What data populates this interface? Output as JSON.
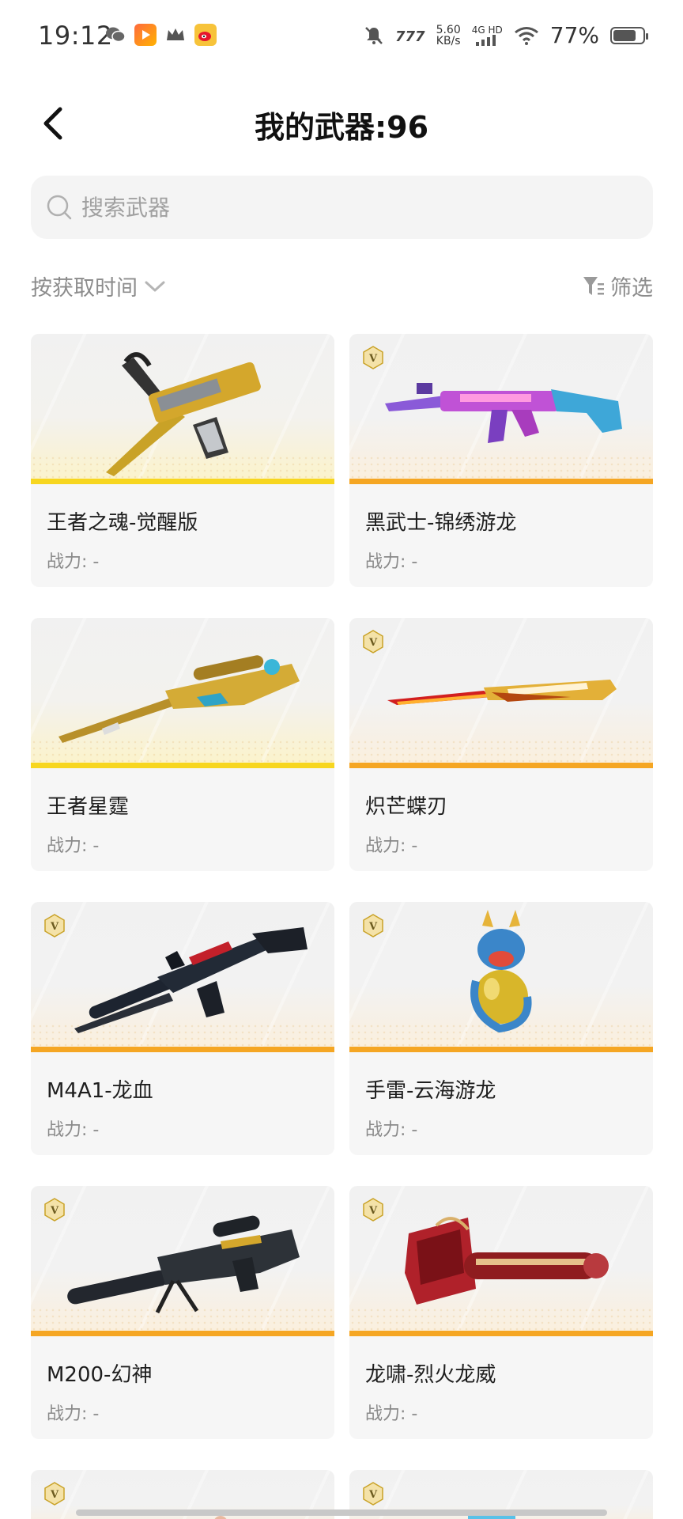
{
  "status_bar": {
    "time": "19:12",
    "speed_value": "5.60",
    "speed_unit": "KB/s",
    "network": "4G HD",
    "battery_percent": "77%",
    "battery_level": 0.77
  },
  "header": {
    "title": "我的武器:96"
  },
  "search": {
    "placeholder": "搜索武器"
  },
  "toolbar": {
    "sort_label": "按获取时间",
    "filter_label": "筛选"
  },
  "weapons": [
    {
      "name": "王者之魂-觉醒版",
      "power": "战力: -",
      "badge": false,
      "tier": "gold",
      "icon": "pistol-dagger-icon"
    },
    {
      "name": "黑武士-锦绣游龙",
      "power": "战力: -",
      "badge": true,
      "tier": "orange",
      "icon": "rifle-icon"
    },
    {
      "name": "王者星霆",
      "power": "战力: -",
      "badge": false,
      "tier": "gold",
      "icon": "sniper-rifle-icon"
    },
    {
      "name": "炽芒蝶刃",
      "power": "战力: -",
      "badge": true,
      "tier": "orange",
      "icon": "butterfly-knife-icon"
    },
    {
      "name": "M4A1-龙血",
      "power": "战力: -",
      "badge": true,
      "tier": "orange",
      "icon": "assault-rifle-icon"
    },
    {
      "name": "手雷-云海游龙",
      "power": "战力: -",
      "badge": true,
      "tier": "orange",
      "icon": "dragon-grenade-icon"
    },
    {
      "name": "M200-幻神",
      "power": "战力: -",
      "badge": true,
      "tier": "orange",
      "icon": "heavy-sniper-icon"
    },
    {
      "name": "龙啸-烈火龙威",
      "power": "战力: -",
      "badge": true,
      "tier": "orange",
      "icon": "axe-icon"
    }
  ],
  "badge_letter": "V",
  "colors": {
    "gold_stripe": "#f7d61f",
    "orange_stripe": "#f5a623",
    "muted_text": "#8c8c8c"
  }
}
